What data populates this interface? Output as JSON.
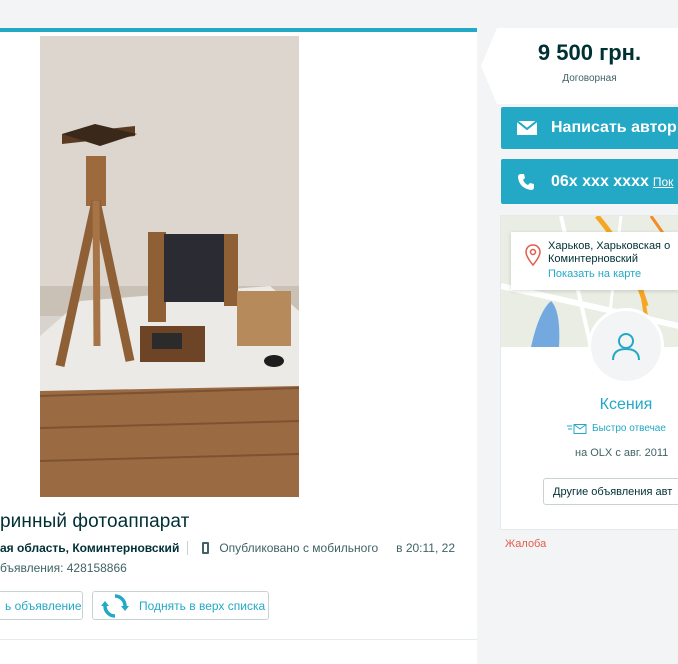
{
  "listing": {
    "title": "ринный фотоаппарат",
    "location": "ая область, Коминтерновский",
    "published": "Опубликовано с мобильного",
    "time": "в 20:11, 22",
    "ad_id": "бъявления: 428158866",
    "save_label": "ь объявление",
    "promote_label": "Поднять в верх списка"
  },
  "price": {
    "value": "9 500 грн.",
    "note": "Договорная"
  },
  "contact": {
    "write_label": "Написать автор",
    "phone": "06x xxx xxxx",
    "show_label": "Пок"
  },
  "map": {
    "address_line1": "Харьков, Харьковская о",
    "address_line2": "Коминтерновский",
    "show_on_map": "Показать на карте"
  },
  "seller": {
    "name": "Ксения",
    "fast_reply": "Быстро отвечае",
    "since": "на OLX с авг. 2011",
    "other_ads": "Другие объявления авт"
  },
  "complaint": "Жалоба",
  "colors": {
    "accent": "#23a9c6",
    "text_dark": "#002f34",
    "complaint": "#e25d4b"
  }
}
